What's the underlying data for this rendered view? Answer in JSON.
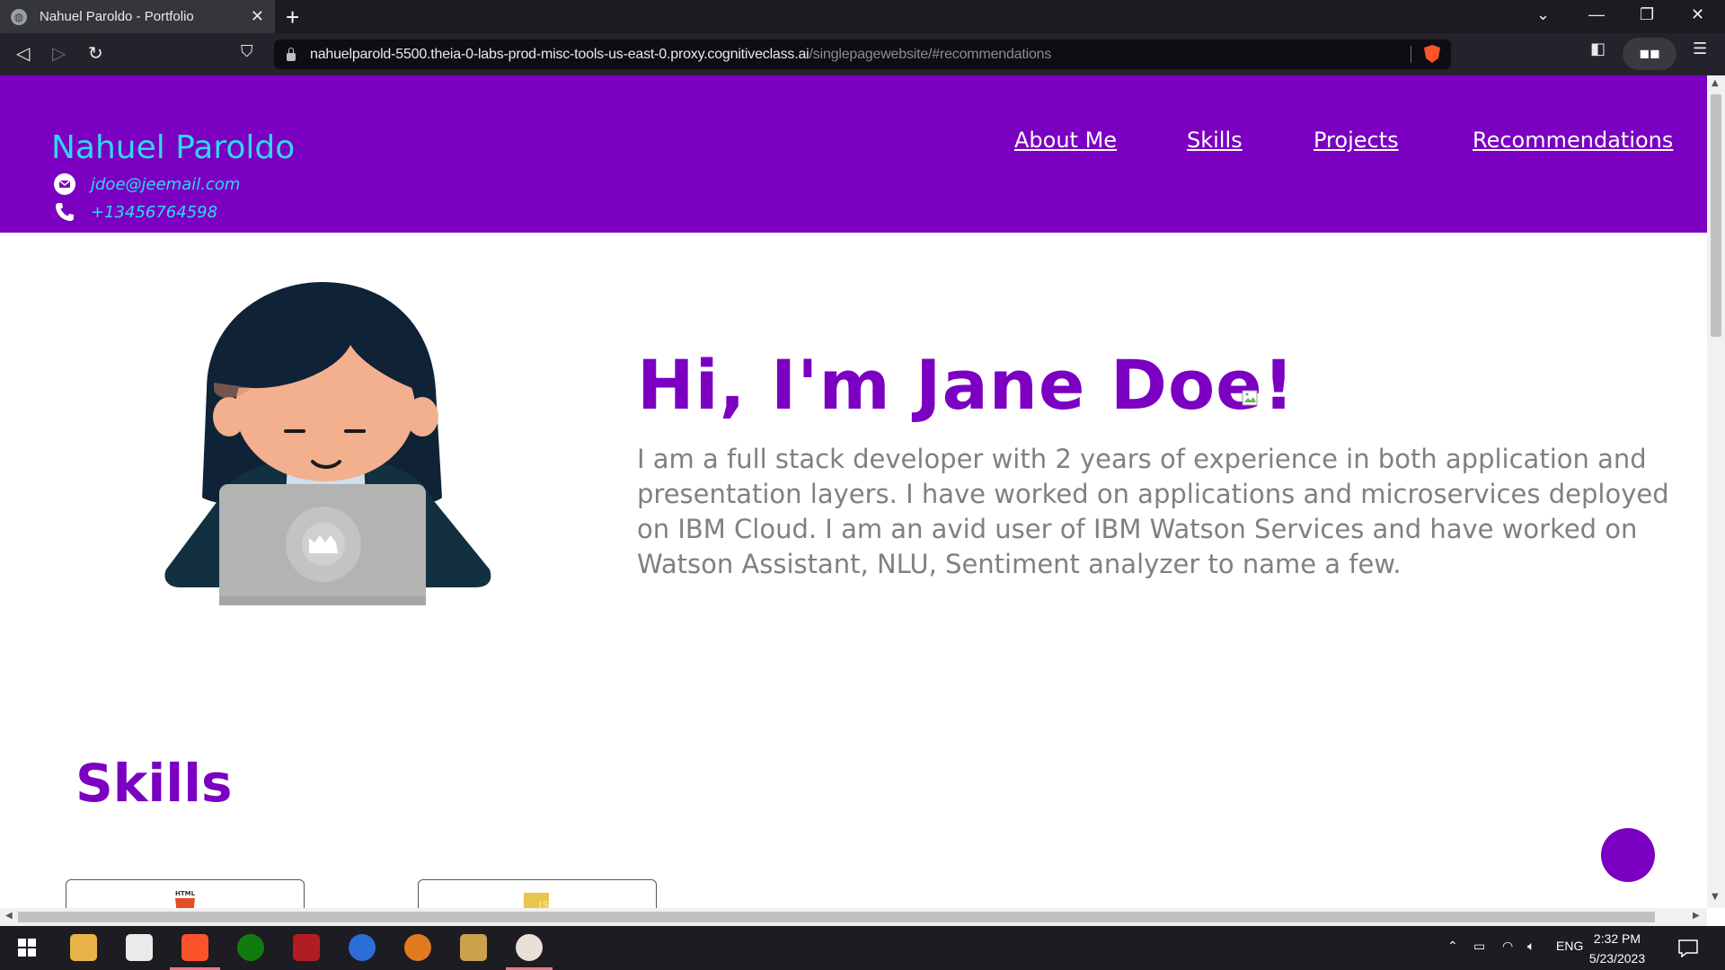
{
  "browser": {
    "tab_title": "Nahuel Paroldo - Portfolio",
    "tab_close": "✕",
    "new_tab": "+",
    "url_host": "nahuelparold-5500.theia-0-labs-prod-misc-tools-us-east-0.proxy.cognitiveclass.ai",
    "url_path": "/singlepagewebsite/#recommendations"
  },
  "site": {
    "brand": "Nahuel Paroldo",
    "email": "jdoe@jeemail.com",
    "phone": "+13456764598",
    "nav": [
      "About Me",
      "Skills",
      "Projects",
      "Recommendations"
    ]
  },
  "hero": {
    "title": "Hi, I'm Jane Doe!",
    "text": "I am a full stack developer with 2 years of experience in both application and presentation layers. I have worked on applications and microservices deployed on IBM Cloud. I am an avid user of IBM Watson Services and have worked on Watson Assistant, NLU, Sentiment analyzer to name a few."
  },
  "skills": {
    "title": "Skills",
    "cards": [
      {
        "icon": "html-icon",
        "label": "HTML"
      },
      {
        "icon": "js-icon",
        "label": "JS"
      }
    ]
  },
  "taskbar": {
    "language": "ENG",
    "time": "2:32 PM",
    "date": "5/23/2023"
  },
  "colors": {
    "header": "#7b00c2",
    "brand_text": "#2ed8f0",
    "title": "#7b00c2",
    "body_text": "#808080"
  }
}
